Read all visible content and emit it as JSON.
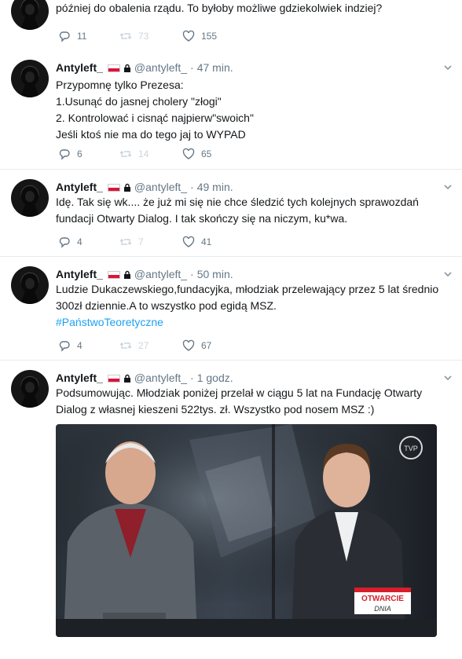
{
  "tweets": [
    {
      "name": "",
      "handle": "",
      "time": "",
      "text": [
        "później do obalenia rządu. To byłoby możliwe gdziekolwiek indziej?"
      ],
      "hashtag": "",
      "replies": "11",
      "retweets": "73",
      "likes": "155"
    },
    {
      "name": "Antyleft_",
      "handle": "@antyleft_",
      "time": "47 min.",
      "text": [
        "Przypomnę tylko Prezesa:",
        "1.Usunąć do jasnej cholery \"złogi\"",
        "2. Kontrolować i cisnąć najpierw\"swoich\"",
        "Jeśli ktoś nie ma do tego jaj to WYPAD"
      ],
      "hashtag": "",
      "replies": "6",
      "retweets": "14",
      "likes": "65"
    },
    {
      "name": "Antyleft_",
      "handle": "@antyleft_",
      "time": "49 min.",
      "text": [
        "Idę. Tak się wk.... że już mi się nie chce śledzić tych kolejnych sprawozdań",
        "fundacji Otwarty Dialog. I tak skończy się na niczym, ku*wa."
      ],
      "hashtag": "",
      "replies": "4",
      "retweets": "7",
      "likes": "41"
    },
    {
      "name": "Antyleft_",
      "handle": "@antyleft_",
      "time": "50 min.",
      "text": [
        "Ludzie Dukaczewskiego,fundacyjka, młodziak przelewający przez 5 lat średnio",
        "300zł dziennie.A to wszystko pod egidą MSZ."
      ],
      "hashtag": "#PaństwoTeoretyczne",
      "replies": "4",
      "retweets": "27",
      "likes": "67"
    },
    {
      "name": "Antyleft_",
      "handle": "@antyleft_",
      "time": "1 godz.",
      "text": [
        "Podsumowując. Młodziak poniżej przelał w ciągu 5 lat na Fundację Otwarty",
        "Dialog z własnej kieszeni 522tys. zł. Wszystko pod nosem MSZ :)"
      ],
      "hashtag": "",
      "replies": "",
      "retweets": "",
      "likes": ""
    }
  ],
  "media": {
    "tv_badge_line1": "OTWARCIE",
    "tv_badge_line2": "DNIA",
    "channel_logo": "TVP"
  },
  "icons": {
    "reply": "reply-icon",
    "retweet": "retweet-icon",
    "like": "heart-icon",
    "caret": "chevron-down-icon",
    "lock": "lock-icon",
    "flag": "poland-flag-icon"
  },
  "colors": {
    "link": "#1da1f2",
    "muted": "#657786",
    "border": "#e6ecf0",
    "retweet_disabled": "#ccd6dd"
  }
}
